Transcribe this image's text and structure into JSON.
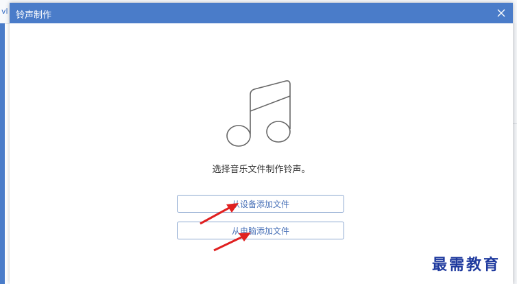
{
  "background": {
    "top_text": "vl"
  },
  "dialog": {
    "title": "铃声制作",
    "close_icon": "close-icon",
    "music_icon": "music-note-icon",
    "prompt": "选择音乐文件制作铃声。",
    "buttons": {
      "from_device": "从设备添加文件",
      "from_computer": "从电脑添加文件"
    }
  },
  "watermark": "最需教育",
  "colors": {
    "titlebar": "#4a7cc9",
    "button_text": "#4a72b8",
    "button_border": "#8aa6cf",
    "arrow": "#e02020",
    "watermark": "#1f3a9e"
  }
}
